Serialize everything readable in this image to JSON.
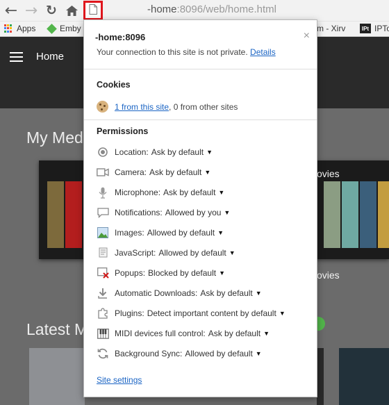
{
  "browser": {
    "url_host": "-home",
    "url_rest": ":8096/web/home.html",
    "bookmarks": [
      {
        "label": "Apps",
        "icon": "apps-grid-icon"
      },
      {
        "label": "Emby",
        "icon": "emby-icon"
      },
      {
        "label": "m - Xirv",
        "icon": ""
      },
      {
        "label": "IPTo",
        "icon": "ipt-icon"
      }
    ]
  },
  "page": {
    "header_title": "Home",
    "section_my_media": "My Med",
    "tile_label_movies": "ovies",
    "tile_label_movies_2": "ovies",
    "section_latest": "Latest M"
  },
  "popup": {
    "host": "-home:8096",
    "close_glyph": "×",
    "connection_text": "Your connection to this site is not private.",
    "details_link": "Details",
    "cookies_heading": "Cookies",
    "cookies_link": "1 from this site",
    "cookies_rest": ", 0 from other sites",
    "permissions_heading": "Permissions",
    "permissions": [
      {
        "label": "Location:",
        "value": "Ask by default",
        "icon": "location-icon"
      },
      {
        "label": "Camera:",
        "value": "Ask by default",
        "icon": "camera-icon"
      },
      {
        "label": "Microphone:",
        "value": "Ask by default",
        "icon": "microphone-icon"
      },
      {
        "label": "Notifications:",
        "value": "Allowed by you",
        "icon": "notifications-icon"
      },
      {
        "label": "Images:",
        "value": "Allowed by default",
        "icon": "images-icon"
      },
      {
        "label": "JavaScript:",
        "value": "Allowed by default",
        "icon": "javascript-icon"
      },
      {
        "label": "Popups:",
        "value": "Blocked by default",
        "icon": "popups-icon"
      },
      {
        "label": "Automatic Downloads:",
        "value": "Ask by default",
        "icon": "download-icon"
      },
      {
        "label": "Plugins:",
        "value": "Detect important content by default",
        "icon": "plugin-icon"
      },
      {
        "label": "MIDI devices full control:",
        "value": "Ask by default",
        "icon": "midi-icon"
      },
      {
        "label": "Background Sync:",
        "value": "Allowed by default",
        "icon": "sync-icon"
      }
    ],
    "site_settings_link": "Site settings"
  },
  "colors": {
    "highlight_border": "#e0161d",
    "link": "#1a64c4",
    "emby_green": "#52b54b",
    "header_bg": "#2a2a2a",
    "page_bg": "#6b6b6b"
  }
}
